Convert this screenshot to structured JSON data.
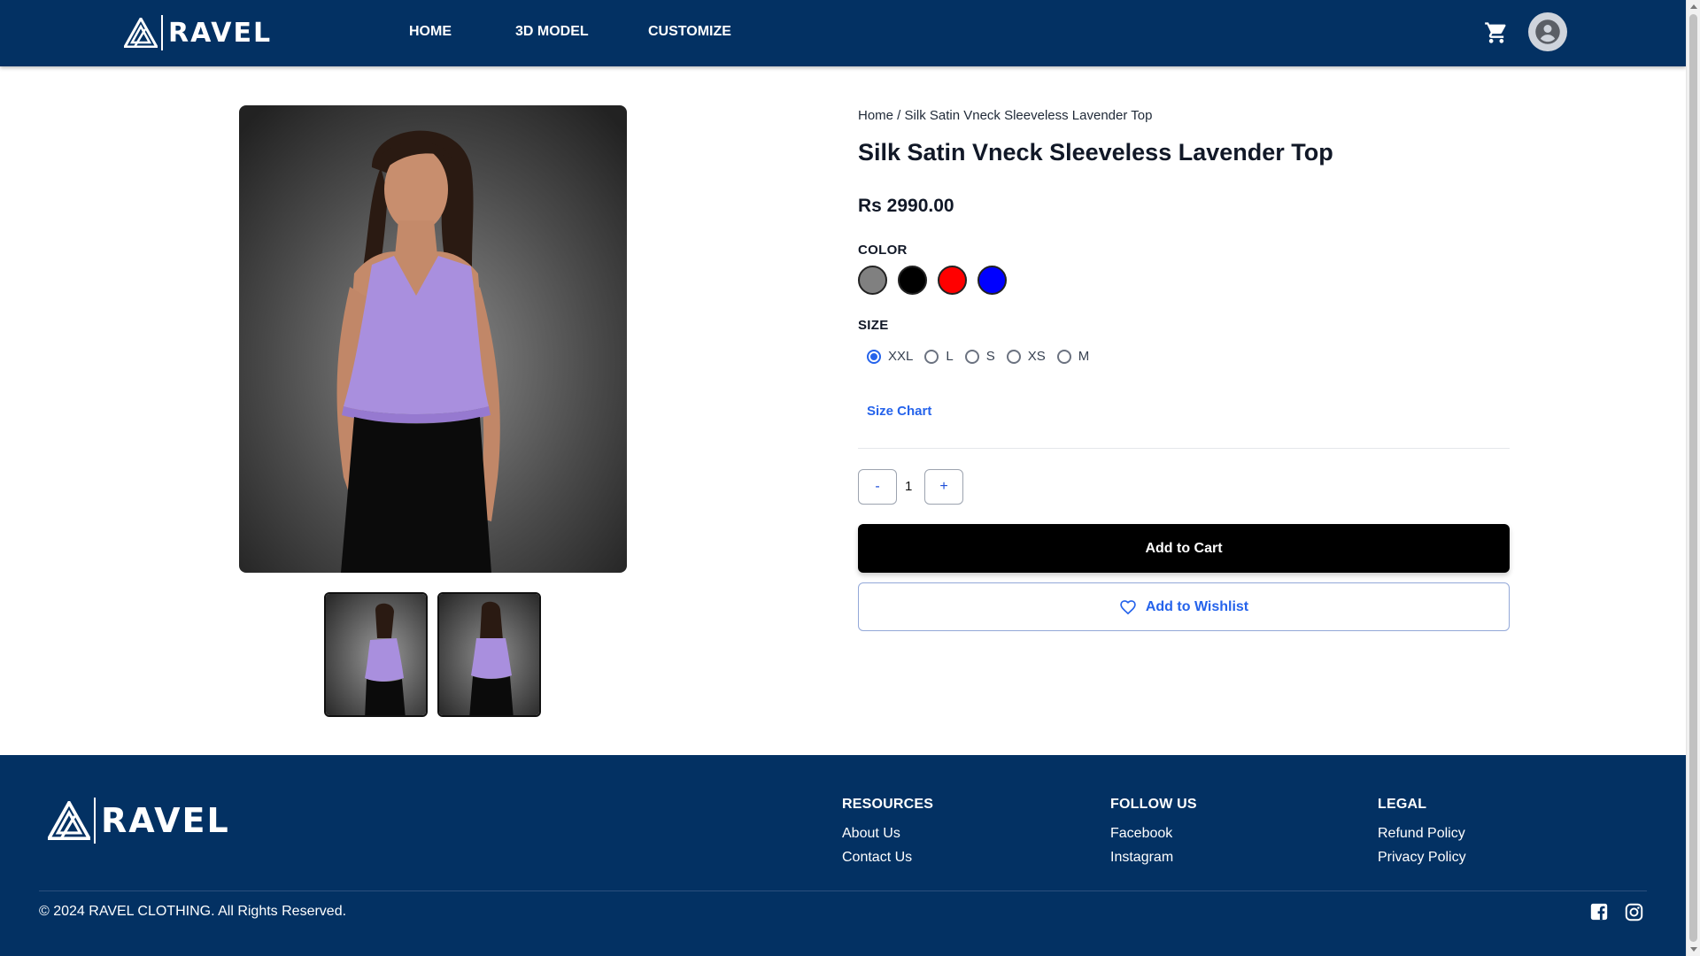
{
  "header": {
    "brand": "RAVEL",
    "nav": [
      {
        "label": "HOME"
      },
      {
        "label": "3D MODEL"
      },
      {
        "label": "CUSTOMIZE"
      }
    ],
    "icons": {
      "cart": "cart-icon",
      "profile": "user-icon"
    }
  },
  "product": {
    "breadcrumb": {
      "home": "Home",
      "separator": " / ",
      "current": "Silk Satin Vneck Sleeveless Lavender Top"
    },
    "title": "Silk Satin Vneck Sleeveless Lavender Top",
    "price": "Rs 2990.00",
    "color_label": "COLOR",
    "colors": [
      "#808080",
      "#000000",
      "#ff0000",
      "#0000ff"
    ],
    "size_label": "SIZE",
    "sizes": [
      {
        "label": "XXL",
        "selected": true
      },
      {
        "label": "L",
        "selected": false
      },
      {
        "label": "S",
        "selected": false
      },
      {
        "label": "XS",
        "selected": false
      },
      {
        "label": "M",
        "selected": false
      }
    ],
    "size_chart_label": "Size Chart",
    "quantity": {
      "minus": "-",
      "value": "1",
      "plus": "+"
    },
    "add_to_cart": "Add to Cart",
    "add_to_wishlist": "Add to Wishlist"
  },
  "footer": {
    "brand": "RAVEL",
    "columns": [
      {
        "heading": "RESOURCES",
        "links": [
          "About Us",
          "Contact Us"
        ]
      },
      {
        "heading": "FOLLOW US",
        "links": [
          "Facebook",
          "Instagram"
        ]
      },
      {
        "heading": "LEGAL",
        "links": [
          "Refund Policy",
          "Privacy Policy"
        ]
      }
    ],
    "copyright": "© 2024 RAVEL CLOTHING. All Rights Reserved.",
    "social_icons": [
      "facebook-icon",
      "instagram-icon"
    ]
  },
  "colors": {
    "header_bg": "#033163",
    "accent": "#2563eb",
    "button_bg": "#000000"
  }
}
